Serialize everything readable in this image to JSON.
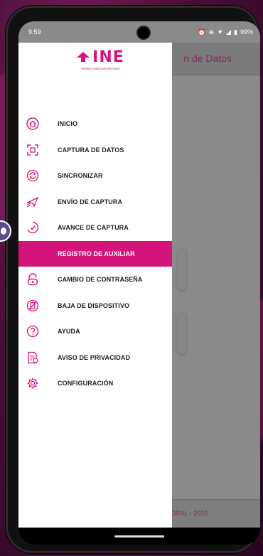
{
  "statusbar": {
    "time": "9:59",
    "battery": "99%"
  },
  "logo": {
    "text": "INE",
    "subtitle": "Instituto Nacional Electoral"
  },
  "app": {
    "title_partial": "n de Datos",
    "footer_partial": "ORAL - 2025"
  },
  "drawer": {
    "items": [
      {
        "label": "INICIO",
        "icon": "home-icon",
        "active": false
      },
      {
        "label": "CAPTURA DE DATOS",
        "icon": "scan-icon",
        "active": false
      },
      {
        "label": "SINCRONIZAR",
        "icon": "sync-icon",
        "active": false
      },
      {
        "label": "ENVÍO DE CAPTURA",
        "icon": "send-icon",
        "active": false
      },
      {
        "label": "AVANCE DE CAPTURA",
        "icon": "progress-icon",
        "active": false
      },
      {
        "label": "REGISTRO DE AUXILIAR",
        "icon": "register-icon",
        "active": true
      },
      {
        "label": "CAMBIO DE CONTRASEÑA",
        "icon": "password-icon",
        "active": false
      },
      {
        "label": "BAJA DE DISPOSITIVO",
        "icon": "device-removal-icon",
        "active": false
      },
      {
        "label": "AYUDA",
        "icon": "help-icon",
        "active": false
      },
      {
        "label": "AVISO DE PRIVACIDAD",
        "icon": "privacy-notice-icon",
        "active": false
      },
      {
        "label": "CONFIGURACIÓN",
        "icon": "settings-icon",
        "active": false
      }
    ]
  },
  "colors": {
    "accent": "#d4147a",
    "scrim": "#7b7b7b"
  }
}
